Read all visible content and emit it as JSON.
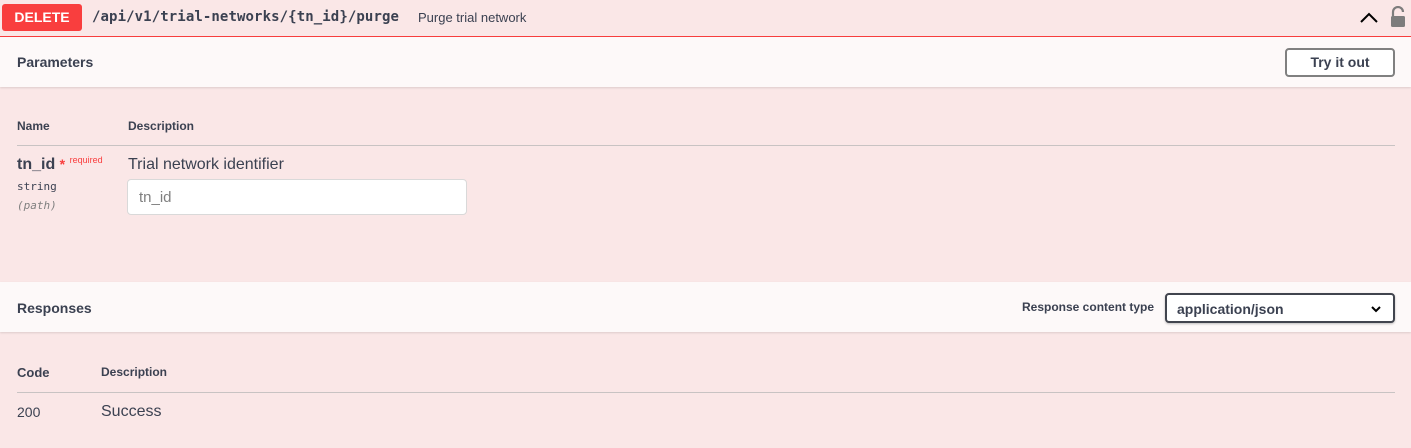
{
  "operation": {
    "method": "DELETE",
    "path": "/api/v1/trial-networks/{tn_id}/purge",
    "summary": "Purge trial network"
  },
  "parameters": {
    "title": "Parameters",
    "try_label": "Try it out",
    "col_name": "Name",
    "col_description": "Description",
    "items": [
      {
        "name": "tn_id",
        "required_star": "*",
        "required_label": "required",
        "type": "string",
        "in": "(path)",
        "description": "Trial network identifier",
        "placeholder": "tn_id"
      }
    ]
  },
  "responses": {
    "title": "Responses",
    "content_type_label": "Response content type",
    "content_type_value": "application/json",
    "col_code": "Code",
    "col_description": "Description",
    "items": [
      {
        "code": "200",
        "description": "Success"
      }
    ]
  },
  "colors": {
    "delete_accent": "#f93e3e",
    "background": "#fae7e7",
    "text": "#3b4151"
  },
  "icons": {
    "collapse": "chevron-up-icon",
    "auth": "unlocked-padlock-icon",
    "dropdown": "chevron-down-icon"
  }
}
